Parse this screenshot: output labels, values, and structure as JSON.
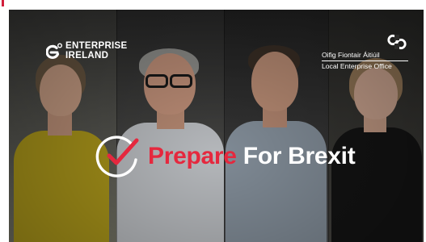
{
  "banner": {
    "headline": {
      "word_accent": "Prepare",
      "word_rest": "For Brexit",
      "accent_color": "#e5283e",
      "text_color": "#ffffff"
    },
    "check_icon": "check-circle-icon"
  },
  "logos": {
    "enterprise_ireland": {
      "line1": "ENTERPRISE",
      "line2": "IRELAND",
      "icon": "enterprise-ireland-mark-icon"
    },
    "local_enterprise_office": {
      "irish_name": "Oifig Fiontair Áitiúil",
      "english_name": "Local Enterprise Office",
      "icon": "local-enterprise-office-mark-icon"
    }
  }
}
